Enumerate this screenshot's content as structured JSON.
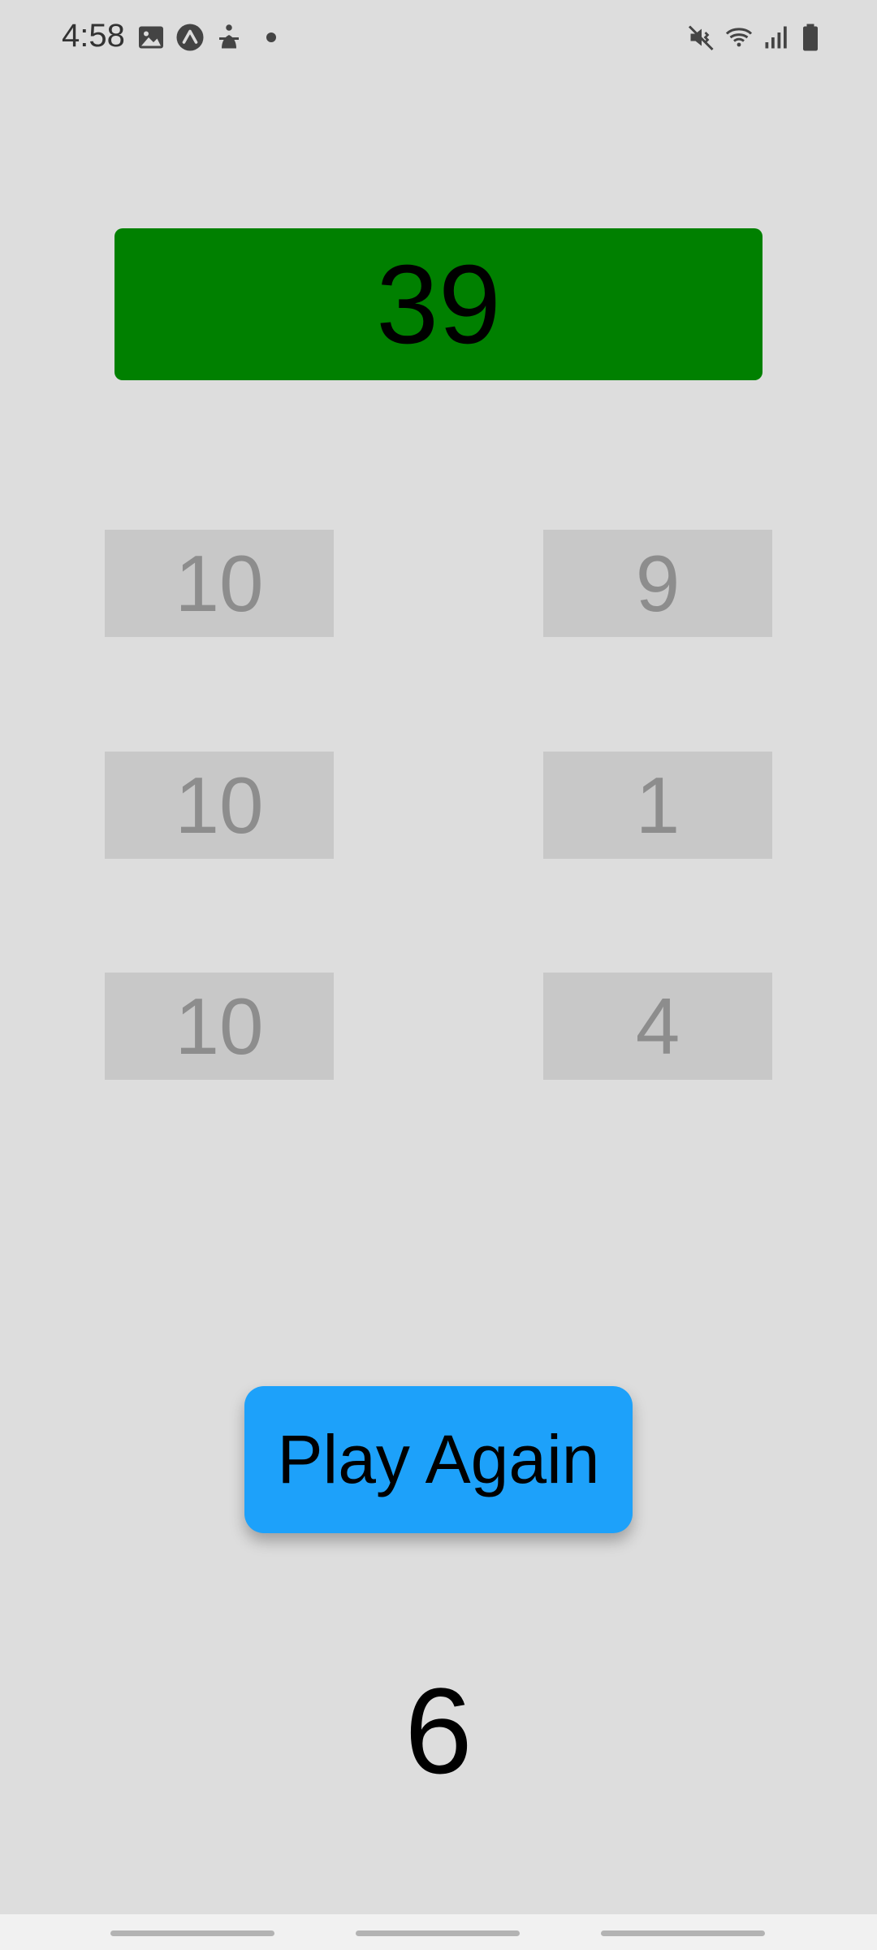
{
  "status_bar": {
    "time": "4:58",
    "left_icons": [
      "image-icon",
      "arrow-up-circle-icon",
      "accessibility-icon",
      "notification-dot-icon"
    ],
    "right_icons": [
      "vibrate-mute-icon",
      "wifi-icon",
      "signal-icon",
      "battery-icon"
    ]
  },
  "game": {
    "target": "39",
    "target_color": "#008000",
    "numbers": [
      "10",
      "9",
      "10",
      "1",
      "10",
      "4"
    ],
    "play_again_label": "Play Again",
    "play_again_color": "#1da1fa",
    "counter": "6"
  },
  "nav": {
    "handles": [
      "recent-apps-handle",
      "home-handle",
      "back-handle"
    ]
  }
}
